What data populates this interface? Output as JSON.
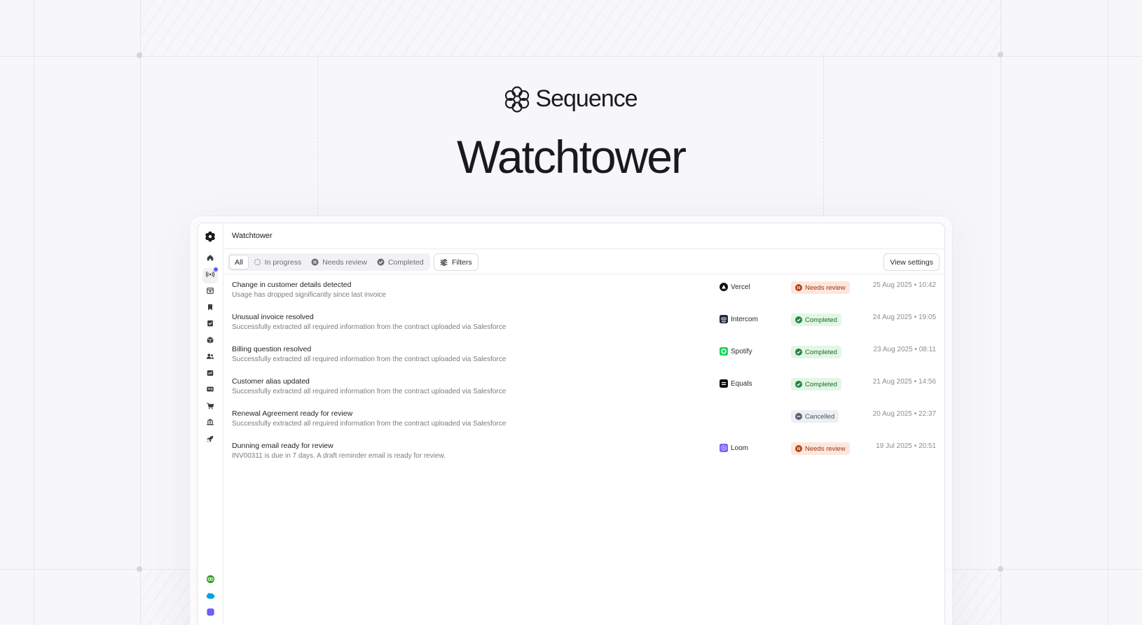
{
  "hero": {
    "brand_name": "Sequence",
    "title": "Watchtower"
  },
  "app": {
    "header_title": "Watchtower",
    "sidebar": {
      "items": [
        {
          "icon": "home-icon"
        },
        {
          "icon": "broadcast-icon",
          "active": true,
          "notification": true
        },
        {
          "icon": "calendar-icon"
        },
        {
          "icon": "bookmark-icon"
        },
        {
          "icon": "checklist-icon"
        },
        {
          "icon": "box-icon"
        },
        {
          "icon": "users-icon"
        },
        {
          "icon": "chart-icon"
        },
        {
          "icon": "id-card-icon"
        },
        {
          "icon": "cart-icon"
        },
        {
          "icon": "bank-icon"
        },
        {
          "icon": "rocket-icon"
        }
      ],
      "bottom": [
        {
          "icon": "quickbooks-icon",
          "color": "#2ca01c"
        },
        {
          "icon": "salesforce-icon",
          "color": "#00a1e0"
        },
        {
          "icon": "app-icon",
          "color": "#6d5dfc"
        }
      ]
    },
    "tabs": [
      {
        "label": "All",
        "active": true,
        "icon": ""
      },
      {
        "label": "In progress",
        "icon": "spinner-icon"
      },
      {
        "label": "Needs review",
        "icon": "pause-icon"
      },
      {
        "label": "Completed",
        "icon": "check-circle-icon"
      }
    ],
    "filters_label": "Filters",
    "view_settings_label": "View settings",
    "rows": [
      {
        "title": "Change in customer details detected",
        "subtitle": "Usage has dropped significantly since last invoice",
        "customer": "Vercel",
        "customer_icon": "vercel-logo-icon",
        "status": "Needs review",
        "timestamp": "25 Aug 2025 • 10:42"
      },
      {
        "title": "Unusual invoice resolved",
        "subtitle": "Successfully extracted all required information from the contract uploaded via Salesforce",
        "customer": "Intercom",
        "customer_icon": "intercom-logo-icon",
        "status": "Completed",
        "timestamp": "24 Aug 2025 • 19:05"
      },
      {
        "title": "Billing question resolved",
        "subtitle": "Successfully extracted all required information from the contract uploaded via Salesforce",
        "customer": "Spotify",
        "customer_icon": "spotify-logo-icon",
        "status": "Completed",
        "timestamp": "23 Aug 2025 • 08:11"
      },
      {
        "title": "Customer alias updated",
        "subtitle": "Successfully extracted all required information from the contract uploaded via Salesforce",
        "customer": "Equals",
        "customer_icon": "equals-logo-icon",
        "status": "Completed",
        "timestamp": "21 Aug 2025 • 14:56"
      },
      {
        "title": "Renewal Agreement ready for review",
        "subtitle": "Successfully extracted all required information from the contract uploaded via Salesforce",
        "customer": "",
        "customer_icon": "",
        "status": "Cancelled",
        "timestamp": "20 Aug 2025 • 22:37"
      },
      {
        "title": "Dunning email ready for review",
        "subtitle": "INV00311 is due in 7 days. A draft reminder email is ready for review.",
        "customer": "Loom",
        "customer_icon": "loom-logo-icon",
        "status": "Needs review",
        "timestamp": "19 Jul 2025 • 20:51"
      }
    ],
    "status_colors": {
      "Needs review": {
        "bg": "#fde7dc",
        "fg": "#9a3412",
        "dot": "#b4441a"
      },
      "Completed": {
        "bg": "#e3f6e6",
        "fg": "#1b6b2a",
        "dot": "#1f8a35"
      },
      "Cancelled": {
        "bg": "#eceff3",
        "fg": "#4b5563",
        "dot": "#5b6473"
      }
    },
    "customer_colors": {
      "Vercel": "#111111",
      "Intercom": "#1f2937",
      "Spotify": "#1ed760",
      "Equals": "#111111",
      "Loom": "#7b61ff"
    }
  }
}
